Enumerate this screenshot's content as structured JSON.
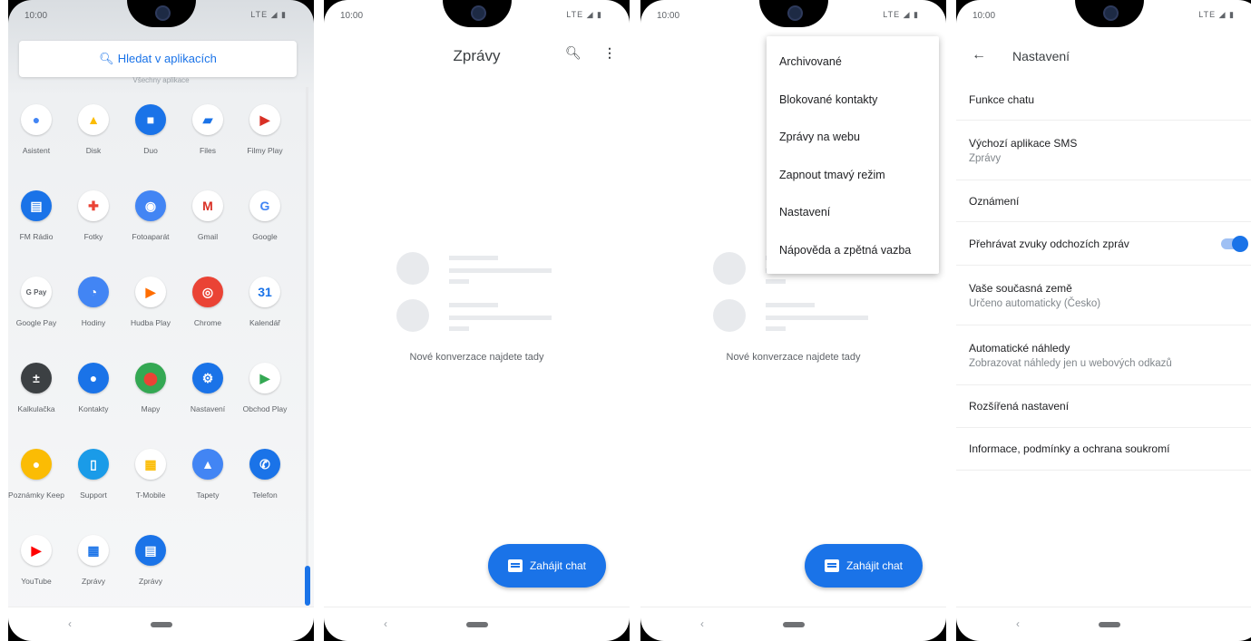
{
  "status": {
    "time": "10:00",
    "signal": "LTE ◢ ▮"
  },
  "nav": {
    "back": "‹"
  },
  "drawer": {
    "search_label": "Hledat v aplikacích",
    "sub_label": "Všechny aplikace",
    "apps": [
      {
        "label": "Asistent",
        "icon": "assistant-icon",
        "glyph": "●",
        "color": "#ffffff",
        "fg": "#4285f4"
      },
      {
        "label": "Disk",
        "icon": "drive-icon",
        "glyph": "▲",
        "color": "#ffffff",
        "fg": "#fbbc04"
      },
      {
        "label": "Duo",
        "icon": "duo-icon",
        "glyph": "■",
        "color": "#1a73e8",
        "fg": "#ffffff"
      },
      {
        "label": "Files",
        "icon": "files-icon",
        "glyph": "▰",
        "color": "#ffffff",
        "fg": "#1a73e8"
      },
      {
        "label": "Filmy Play",
        "icon": "play-movies-icon",
        "glyph": "▶",
        "color": "#ffffff",
        "fg": "#d93025"
      },
      {
        "label": "FM Rádio",
        "icon": "fm-radio-icon",
        "glyph": "▤",
        "color": "#1a73e8",
        "fg": "#ffffff"
      },
      {
        "label": "Fotky",
        "icon": "photos-icon",
        "glyph": "✚",
        "color": "#ffffff",
        "fg": "#ea4335"
      },
      {
        "label": "Fotoaparát",
        "icon": "camera-icon",
        "glyph": "◉",
        "color": "#4285f4",
        "fg": "#ffffff"
      },
      {
        "label": "Gmail",
        "icon": "gmail-icon",
        "glyph": "M",
        "color": "#ffffff",
        "fg": "#d93025"
      },
      {
        "label": "Google",
        "icon": "google-icon",
        "glyph": "G",
        "color": "#ffffff",
        "fg": "#4285f4"
      },
      {
        "label": "Google Pay",
        "icon": "google-pay-icon",
        "glyph": "G Pay",
        "color": "#ffffff",
        "fg": "#5f6368"
      },
      {
        "label": "Hodiny",
        "icon": "clock-icon",
        "glyph": "◔",
        "color": "#4285f4",
        "fg": "#ffffff"
      },
      {
        "label": "Hudba Play",
        "icon": "play-music-icon",
        "glyph": "▶",
        "color": "#ffffff",
        "fg": "#ff6d00"
      },
      {
        "label": "Chrome",
        "icon": "chrome-icon",
        "glyph": "◎",
        "color": "#ea4335",
        "fg": "#ffffff"
      },
      {
        "label": "Kalendář",
        "icon": "calendar-icon",
        "glyph": "31",
        "color": "#ffffff",
        "fg": "#1a73e8"
      },
      {
        "label": "Kalkulačka",
        "icon": "calculator-icon",
        "glyph": "±",
        "color": "#3c4043",
        "fg": "#ffffff"
      },
      {
        "label": "Kontakty",
        "icon": "contacts-icon",
        "glyph": "●",
        "color": "#1a73e8",
        "fg": "#ffffff"
      },
      {
        "label": "Mapy",
        "icon": "maps-icon",
        "glyph": "⬤",
        "color": "#34a853",
        "fg": "#ea4335"
      },
      {
        "label": "Nastavení",
        "icon": "settings-icon",
        "glyph": "⚙",
        "color": "#1a73e8",
        "fg": "#ffffff"
      },
      {
        "label": "Obchod Play",
        "icon": "play-store-icon",
        "glyph": "▶",
        "color": "#ffffff",
        "fg": "#34a853"
      },
      {
        "label": "Poznámky Keep",
        "icon": "keep-icon",
        "glyph": "●",
        "color": "#fbbc04",
        "fg": "#ffffff"
      },
      {
        "label": "Support",
        "icon": "support-icon",
        "glyph": "▯",
        "color": "#1a9be8",
        "fg": "#ffffff"
      },
      {
        "label": "T-Mobile",
        "icon": "tmobile-icon",
        "glyph": "▦",
        "color": "#ffffff",
        "fg": "#fbbc04"
      },
      {
        "label": "Tapety",
        "icon": "wallpapers-icon",
        "glyph": "▲",
        "color": "#4285f4",
        "fg": "#ffffff"
      },
      {
        "label": "Telefon",
        "icon": "phone-icon",
        "glyph": "✆",
        "color": "#1a73e8",
        "fg": "#ffffff"
      },
      {
        "label": "YouTube",
        "icon": "youtube-icon",
        "glyph": "▶",
        "color": "#ffffff",
        "fg": "#ff0000"
      },
      {
        "label": "Zprávy",
        "icon": "messages-sim-icon",
        "glyph": "▦",
        "color": "#ffffff",
        "fg": "#1a73e8"
      },
      {
        "label": "Zprávy",
        "icon": "messages-icon",
        "glyph": "▤",
        "color": "#1a73e8",
        "fg": "#ffffff"
      }
    ]
  },
  "messages": {
    "title": "Zprávy",
    "empty_text": "Nové konverzace najdete tady",
    "fab_label": "Zahájit chat"
  },
  "menu": {
    "items": [
      "Archivované",
      "Blokované kontakty",
      "Zprávy na webu",
      "Zapnout tmavý režim",
      "Nastavení",
      "Nápověda a zpětná vazba"
    ]
  },
  "settings": {
    "title": "Nastavení",
    "rows": [
      {
        "title": "Funkce chatu",
        "subtitle": "",
        "toggle": false
      },
      {
        "title": "Výchozí aplikace SMS",
        "subtitle": "Zprávy",
        "toggle": false
      },
      {
        "title": "Oznámení",
        "subtitle": "",
        "toggle": false
      },
      {
        "title": "Přehrávat zvuky odchozích zpráv",
        "subtitle": "",
        "toggle": true
      },
      {
        "title": "Vaše současná země",
        "subtitle": "Určeno automaticky (Česko)",
        "toggle": false
      },
      {
        "title": "Automatické náhledy",
        "subtitle": "Zobrazovat náhledy jen u webových odkazů",
        "toggle": false
      },
      {
        "title": "Rozšířená nastavení",
        "subtitle": "",
        "toggle": false
      },
      {
        "title": "Informace, podmínky a ochrana soukromí",
        "subtitle": "",
        "toggle": false
      }
    ]
  }
}
